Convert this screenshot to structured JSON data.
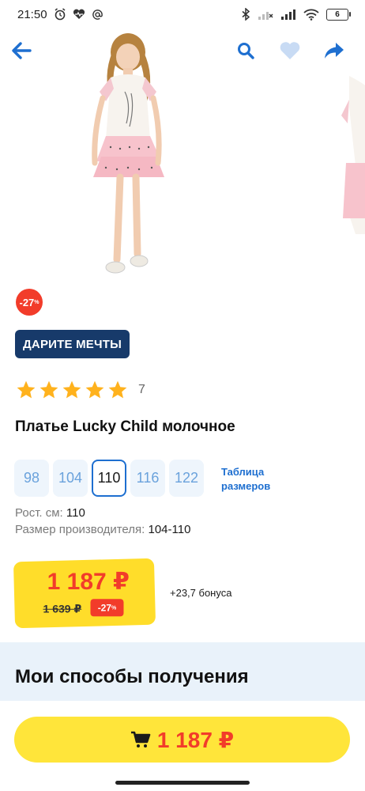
{
  "status_bar": {
    "time": "21:50",
    "battery": "6"
  },
  "header": {
    "icons": [
      "back-arrow-icon",
      "search-icon",
      "heart-icon",
      "share-icon"
    ]
  },
  "discount_badge": {
    "value": "-27",
    "unit": "%"
  },
  "promo": {
    "label": "ДАРИТЕ МЕЧТЫ"
  },
  "rating": {
    "stars": 5,
    "count": "7"
  },
  "product": {
    "title": "Платье Lucky Child молочное"
  },
  "sizes": {
    "options": [
      "98",
      "104",
      "110",
      "116",
      "122"
    ],
    "selected": "110",
    "table_link": "Таблица размеров"
  },
  "info": {
    "height_label": "Рост. см:",
    "height_value": "110",
    "maker_size_label": "Размер производителя:",
    "maker_size_value": "104-110"
  },
  "price": {
    "current": "1 187 ₽",
    "old": "1 639 ₽",
    "discount": "-27",
    "discount_unit": "%",
    "bonus": "+23,7 бонуса"
  },
  "delivery": {
    "title": "Мои способы получения"
  },
  "buy_bar": {
    "price": "1 187 ₽"
  },
  "colors": {
    "accent_blue": "#1e6fd0",
    "price_red": "#f23c2a",
    "price_yellow": "#ffdd2a",
    "promo_navy": "#173a6a"
  }
}
